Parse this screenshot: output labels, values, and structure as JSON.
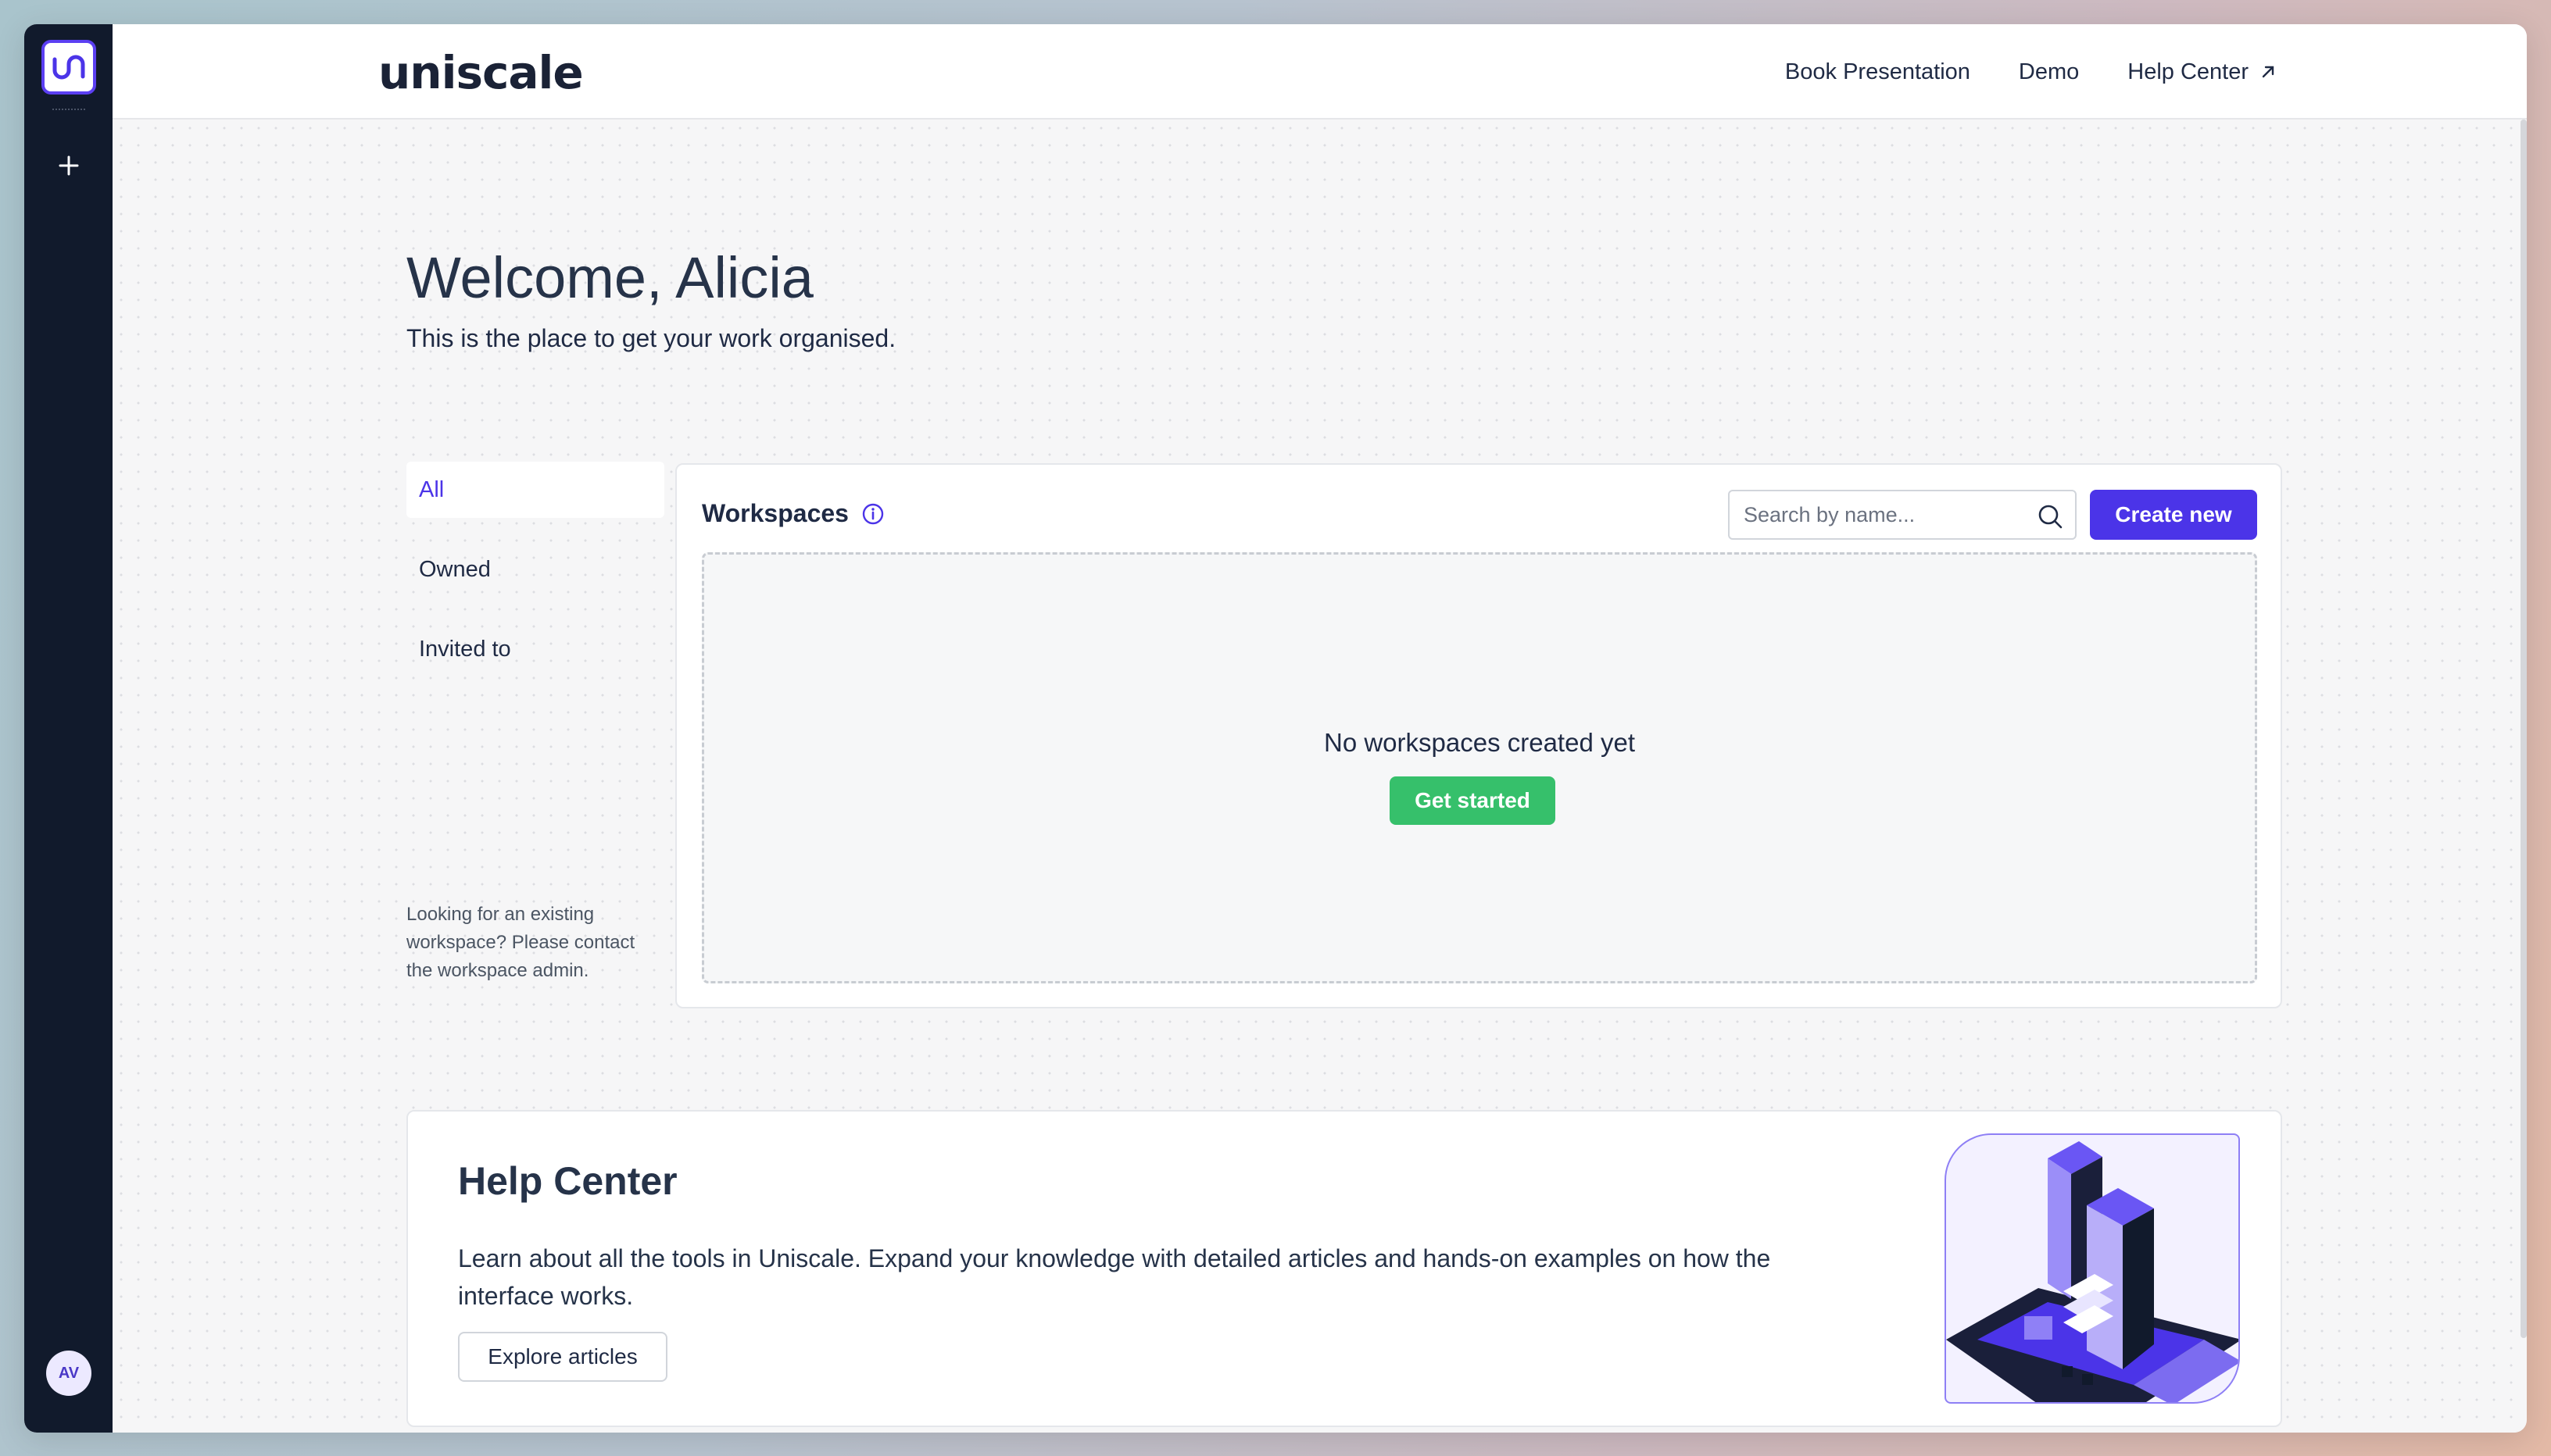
{
  "rail": {
    "avatar_initials": "AV"
  },
  "brand": {
    "name": "uniscale"
  },
  "nav": {
    "book": "Book Presentation",
    "demo": "Demo",
    "help": "Help Center"
  },
  "page": {
    "title": "Welcome, Alicia",
    "subtitle": "This is the place to get your work organised."
  },
  "filters": {
    "items": [
      {
        "label": "All"
      },
      {
        "label": "Owned"
      },
      {
        "label": "Invited to"
      }
    ],
    "selected": "All",
    "note": "Looking for an existing workspace? Please contact the workspace admin."
  },
  "workspaces": {
    "title": "Workspaces",
    "search_placeholder": "Search by name...",
    "create_label": "Create new",
    "empty_text": "No workspaces created yet",
    "get_started_label": "Get started"
  },
  "help": {
    "title": "Help Center",
    "description": "Learn about all the tools in Uniscale. Expand your knowledge with detailed articles and hands-on examples on how the interface works.",
    "button_label": "Explore articles"
  },
  "colors": {
    "accent": "#4b34e8",
    "success": "#36c06b",
    "rail": "#111a2c"
  },
  "icons": [
    "uniscale-logo-icon",
    "plus-icon",
    "external-link-icon",
    "info-icon",
    "search-icon"
  ]
}
